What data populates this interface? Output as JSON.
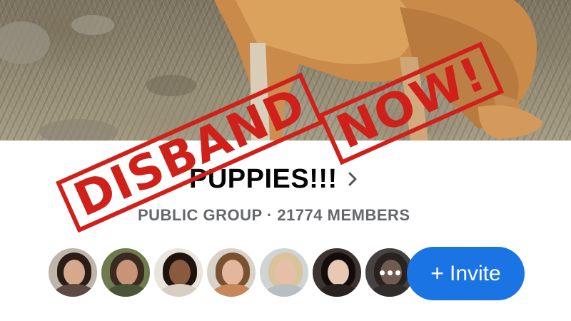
{
  "group": {
    "name": "PUPPIES!!!",
    "subtitle": "PUBLIC GROUP · 21774 MEMBERS"
  },
  "stamp": {
    "word1": "DISBAND",
    "word2": "NOW!"
  },
  "actions": {
    "invite_label": "Invite",
    "invite_icon": "plus-icon"
  },
  "member_avatars": [
    {
      "name": "member-avatar-1"
    },
    {
      "name": "member-avatar-2"
    },
    {
      "name": "member-avatar-3"
    },
    {
      "name": "member-avatar-4"
    },
    {
      "name": "member-avatar-5"
    },
    {
      "name": "member-avatar-6"
    },
    {
      "name": "member-avatar-more",
      "icon": "more-icon"
    }
  ],
  "colors": {
    "invite_button": "#1b74e4",
    "stamp_red": "#d0201a",
    "subtitle_gray": "#65676b"
  }
}
